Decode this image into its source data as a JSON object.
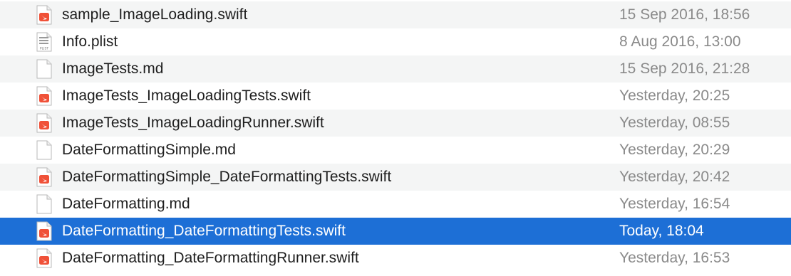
{
  "files": [
    {
      "name": "sample_ImageLoading.swift",
      "modified": "15 Sep 2016, 18:56",
      "icon": "swift-file-icon",
      "selected": false
    },
    {
      "name": "Info.plist",
      "modified": "8 Aug 2016, 13:00",
      "icon": "plist-file-icon",
      "selected": false
    },
    {
      "name": "ImageTests.md",
      "modified": "15 Sep 2016, 21:28",
      "icon": "document-file-icon",
      "selected": false
    },
    {
      "name": "ImageTests_ImageLoadingTests.swift",
      "modified": "Yesterday, 20:25",
      "icon": "swift-file-icon",
      "selected": false
    },
    {
      "name": "ImageTests_ImageLoadingRunner.swift",
      "modified": "Yesterday, 08:55",
      "icon": "swift-file-icon",
      "selected": false
    },
    {
      "name": "DateFormattingSimple.md",
      "modified": "Yesterday, 20:29",
      "icon": "document-file-icon",
      "selected": false
    },
    {
      "name": "DateFormattingSimple_DateFormattingTests.swift",
      "modified": "Yesterday, 20:42",
      "icon": "swift-file-icon",
      "selected": false
    },
    {
      "name": "DateFormatting.md",
      "modified": "Yesterday, 16:54",
      "icon": "document-file-icon",
      "selected": false
    },
    {
      "name": "DateFormatting_DateFormattingTests.swift",
      "modified": "Today, 18:04",
      "icon": "swift-file-icon",
      "selected": true
    },
    {
      "name": "DateFormatting_DateFormattingRunner.swift",
      "modified": "Yesterday, 16:53",
      "icon": "swift-file-icon",
      "selected": false
    }
  ],
  "plist_badge": "PLIST",
  "colors": {
    "selection": "#1d6fd6",
    "alt_row": "#f4f5f5",
    "swift_orange": "#f05138",
    "date_text": "#8a8a8a"
  }
}
